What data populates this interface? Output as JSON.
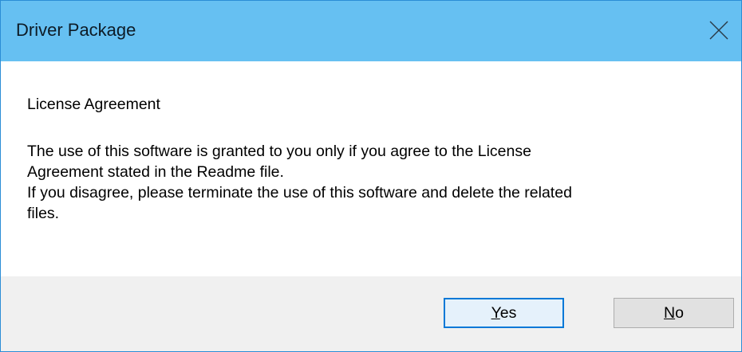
{
  "window": {
    "title": "Driver Package",
    "close_icon": "close-icon"
  },
  "message": {
    "heading": "License Agreement",
    "lines": [
      "The use of this software is granted to you only if you agree to the License",
      "Agreement stated in the Readme file.",
      "If you disagree, please terminate the use of this software and delete the related",
      "files."
    ]
  },
  "buttons": {
    "yes": {
      "accel": "Y",
      "rest": "es"
    },
    "no": {
      "accel": "N",
      "rest": "o"
    }
  },
  "colors": {
    "titlebar": "#66c0f2",
    "border": "#2b8dd6",
    "footer": "#f0f0f0",
    "default_button_border": "#0078d7"
  }
}
